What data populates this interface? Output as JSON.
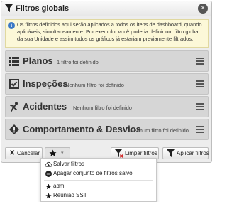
{
  "window": {
    "title": "Filtros globais",
    "close_icon": "×"
  },
  "info": {
    "text": "Os filtros definidos aqui serão aplicados a todos os itens de dashboard, quando aplicáveis, simultaneamente. Por exemplo, você poderia definir um filtro global da sua Unidade e assim todos os gráficos já estariam previamente filtrados."
  },
  "filters": [
    {
      "name": "Planos",
      "status": "1 filtro foi definido",
      "icon": "list-icon"
    },
    {
      "name": "Inspeções",
      "status": "Nenhum filtro foi definido",
      "icon": "checkbox-icon"
    },
    {
      "name": "Acidentes",
      "status": "Nenhum filtro foi definido",
      "icon": "falling-person-icon"
    },
    {
      "name": "Comportamento & Desvios",
      "status": "Nenhum filtro foi definido",
      "icon": "warning-diamond-icon"
    }
  ],
  "toolbar": {
    "cancel_label": "Cancelar",
    "clear_label": "Limpar filtros",
    "apply_label": "Aplicar filtros"
  },
  "favorites_menu": {
    "items": [
      {
        "label": "Salvar filtros",
        "icon": "save-cloud-icon"
      },
      {
        "label": "Apagar conjunto de filtros salvo",
        "icon": "minus-circle-icon"
      },
      {
        "label": "adm",
        "icon": "star-icon"
      },
      {
        "label": "Reunião SST",
        "icon": "star-icon"
      }
    ]
  },
  "colors": {
    "panel_bg": "#ededed",
    "row_bg": "#d6d6d6",
    "info_bg": "#fcf8d8",
    "info_icon": "#3b78c6",
    "clear_icon_red": "#d22b2b"
  }
}
